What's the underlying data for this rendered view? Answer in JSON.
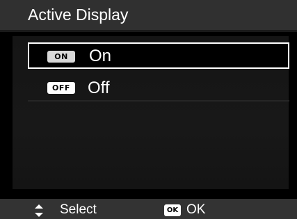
{
  "title": "Active Display",
  "menu": {
    "items": [
      {
        "badge": "ON",
        "label": "On",
        "selected": true
      },
      {
        "badge": "OFF",
        "label": "Off",
        "selected": false
      }
    ]
  },
  "hints": {
    "select_icon": "up-down-arrows-icon",
    "select_label": "Select",
    "ok_badge": "OK",
    "ok_label": "OK"
  },
  "colors": {
    "title_bar": "#303030",
    "hint_bar": "#333333",
    "selection_border": "#ffffff"
  }
}
